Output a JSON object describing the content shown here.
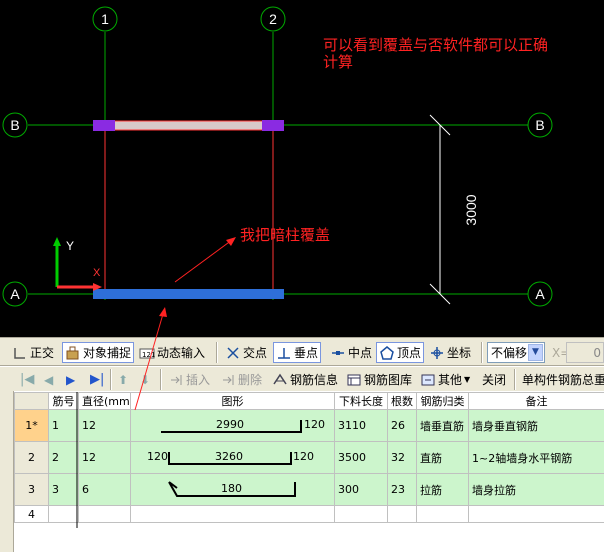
{
  "canvas": {
    "axes": {
      "col1": "1",
      "col2": "2",
      "rowB_left": "B",
      "rowB_right": "B",
      "rowA_left": "A",
      "rowA_right": "A"
    },
    "dimension": "3000",
    "annotation_top": "可以看到覆盖与否软件都可以正确计算",
    "annotation_mid": "我把暗柱覆盖",
    "ucs_y": "Y",
    "ucs_x": "X",
    "colors": {
      "background": "#000000",
      "grid": "#00aa00",
      "beam": "#2e6fd8",
      "wall_red": "#ff3333",
      "column": "#8a2be2",
      "annotation": "#ff2222"
    }
  },
  "snapbar": {
    "ortho": "正交",
    "object_snap": "对象捕捉",
    "dynamic_input": "动态输入",
    "intersection": "交点",
    "perpendicular": "垂点",
    "midpoint": "中点",
    "vertex": "顶点",
    "coordinate": "坐标",
    "offset_select": "不偏移",
    "x_label": "X=",
    "x_value": "0"
  },
  "gridbar": {
    "insert": "插入",
    "delete": "删除",
    "rebar_info": "钢筋信息",
    "rebar_library": "钢筋图库",
    "other": "其他",
    "close": "关闭",
    "total": "单构件钢筋总重"
  },
  "table": {
    "headers": [
      "筋号",
      "直径(mm)",
      "图形",
      "下料长度",
      "根数",
      "钢筋归类",
      "备注"
    ],
    "rows": [
      {
        "idx": "1*",
        "no": "1",
        "dia": "12",
        "len": "3110",
        "count": "26",
        "type": "墙垂直筋",
        "note": "墙身垂直钢筋",
        "shape_main": "2990",
        "shape_left": "",
        "shape_right": "120"
      },
      {
        "idx": "2",
        "no": "2",
        "dia": "12",
        "len": "3500",
        "count": "32",
        "type": "直筋",
        "note": "1~2轴墙身水平钢筋",
        "shape_main": "3260",
        "shape_left": "120",
        "shape_right": "120"
      },
      {
        "idx": "3",
        "no": "3",
        "dia": "6",
        "len": "300",
        "count": "23",
        "type": "拉筋",
        "note": "墙身拉筋",
        "shape_main": "180",
        "shape_left": "",
        "shape_right": ""
      },
      {
        "idx": "4",
        "no": "",
        "dia": "",
        "len": "",
        "count": "",
        "type": "",
        "note": "",
        "shape_main": "",
        "shape_left": "",
        "shape_right": ""
      }
    ]
  }
}
